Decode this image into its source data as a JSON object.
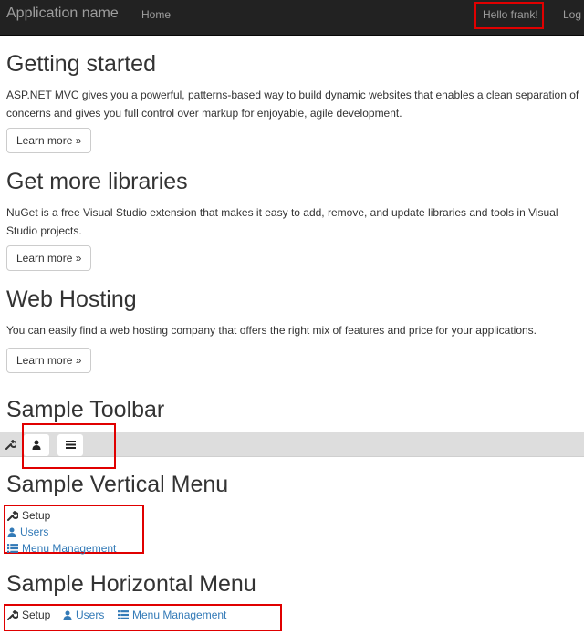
{
  "navbar": {
    "brand": "Application name",
    "home": "Home",
    "greeting": "Hello frank!",
    "logoff": "Log"
  },
  "sections": [
    {
      "title": "Getting started",
      "text": "ASP.NET MVC gives you a powerful, patterns-based way to build dynamic websites that enables a clean separation of concerns and gives you full control over markup for enjoyable, agile development.",
      "button": "Learn more »"
    },
    {
      "title": "Get more libraries",
      "text": "NuGet is a free Visual Studio extension that makes it easy to add, remove, and update libraries and tools in Visual Studio projects.",
      "button": "Learn more »"
    },
    {
      "title": "Web Hosting",
      "text": "You can easily find a web hosting company that offers the right mix of features and price for your applications.",
      "button": "Learn more »"
    }
  ],
  "toolbar": {
    "title": "Sample Toolbar",
    "icons": [
      "wrench-icon",
      "user-icon",
      "list-icon"
    ]
  },
  "vertical_menu": {
    "title": "Sample Vertical Menu",
    "items": [
      {
        "label": "Setup",
        "icon": "wrench-icon"
      },
      {
        "label": "Users",
        "icon": "user-icon"
      },
      {
        "label": "Menu Management",
        "icon": "list-icon"
      }
    ]
  },
  "horizontal_menu": {
    "title": "Sample Horizontal Menu",
    "items": [
      {
        "label": "Setup",
        "icon": "wrench-icon"
      },
      {
        "label": "Users",
        "icon": "user-icon"
      },
      {
        "label": "Menu Management",
        "icon": "list-icon"
      }
    ]
  },
  "colors": {
    "navbar_bg": "#222222",
    "link": "#337ab7",
    "highlight": "#e00000",
    "toolbar_bg": "#dddddd"
  }
}
